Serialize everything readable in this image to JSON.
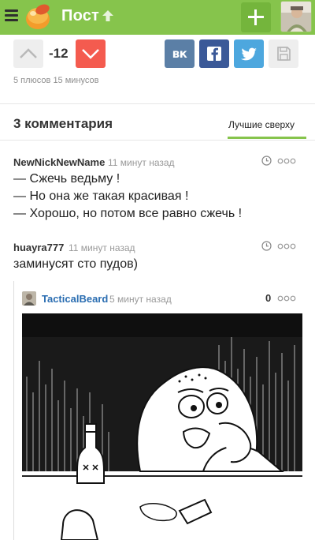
{
  "topbar": {
    "title": "Пост",
    "colors": {
      "bar": "#86c44c",
      "add_button": "#74b53c"
    },
    "icons": [
      "menu-icon",
      "logo-icon",
      "arrow-up-icon",
      "plus-icon",
      "user-avatar"
    ]
  },
  "rating": {
    "value": "-12",
    "stats": "5 плюсов 15 минусов",
    "icons": [
      "chevron-up-icon",
      "chevron-down-icon"
    ],
    "colors": {
      "down": "#f45b4f"
    }
  },
  "share": {
    "vk_label": "вк",
    "icons": [
      "vk-icon",
      "facebook-icon",
      "twitter-icon",
      "save-icon"
    ],
    "colors": {
      "vk": "#5b7fa6",
      "facebook": "#3b5998",
      "twitter": "#4da7de"
    }
  },
  "comments_header": {
    "count_label": "3 комментария",
    "sort_label": "Лучшие сверху"
  },
  "comments": [
    {
      "author": "NewNickNewName",
      "time": "11 минут назад",
      "lines": [
        "— Сжечь ведьму !",
        "— Но она же такая красивая !",
        "— Хорошо, но потом все равно сжечь !"
      ]
    },
    {
      "author": "huayra777",
      "time": "11 минут назад",
      "lines": [
        "заминусят сто пудов)"
      ]
    },
    {
      "author": "TacticalBeard",
      "time": "5 минут назад",
      "rating": "0",
      "image": "sad-meme-comic"
    }
  ]
}
